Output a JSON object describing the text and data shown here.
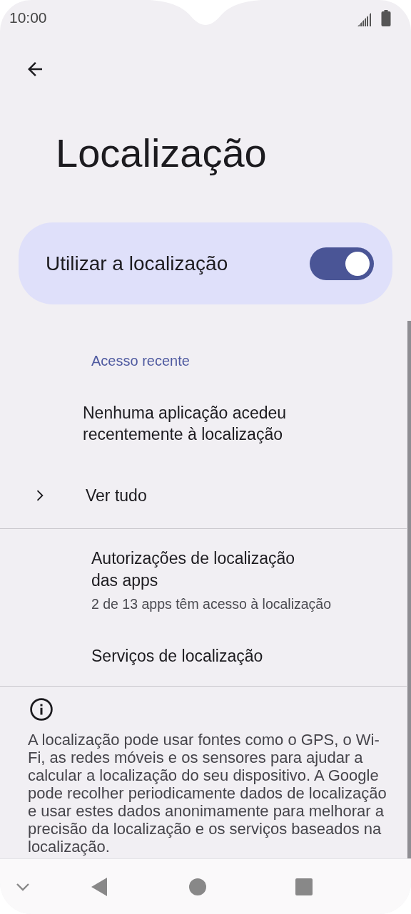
{
  "status_bar": {
    "time": "10:00"
  },
  "title": "Localização",
  "main_switch": {
    "label": "Utilizar a localização",
    "on": true
  },
  "recent_access": {
    "header": "Acesso recente",
    "message": "Nenhuma aplicação acedeu recentemente à localização",
    "see_all": "Ver tudo"
  },
  "items": [
    {
      "title": "Autorizações de localização das apps",
      "subtitle": "2 de 13 apps têm acesso à localização"
    },
    {
      "title": "Serviços de localização"
    }
  ],
  "footer": "A localização pode usar fontes como o GPS, o Wi-Fi, as redes móveis e os sensores para ajudar a calcular a localização do seu dispositivo. A Google pode recolher periodicamente dados de localização e usar estes dados anonimamente para melhorar a precisão da localização e os serviços baseados na localização."
}
